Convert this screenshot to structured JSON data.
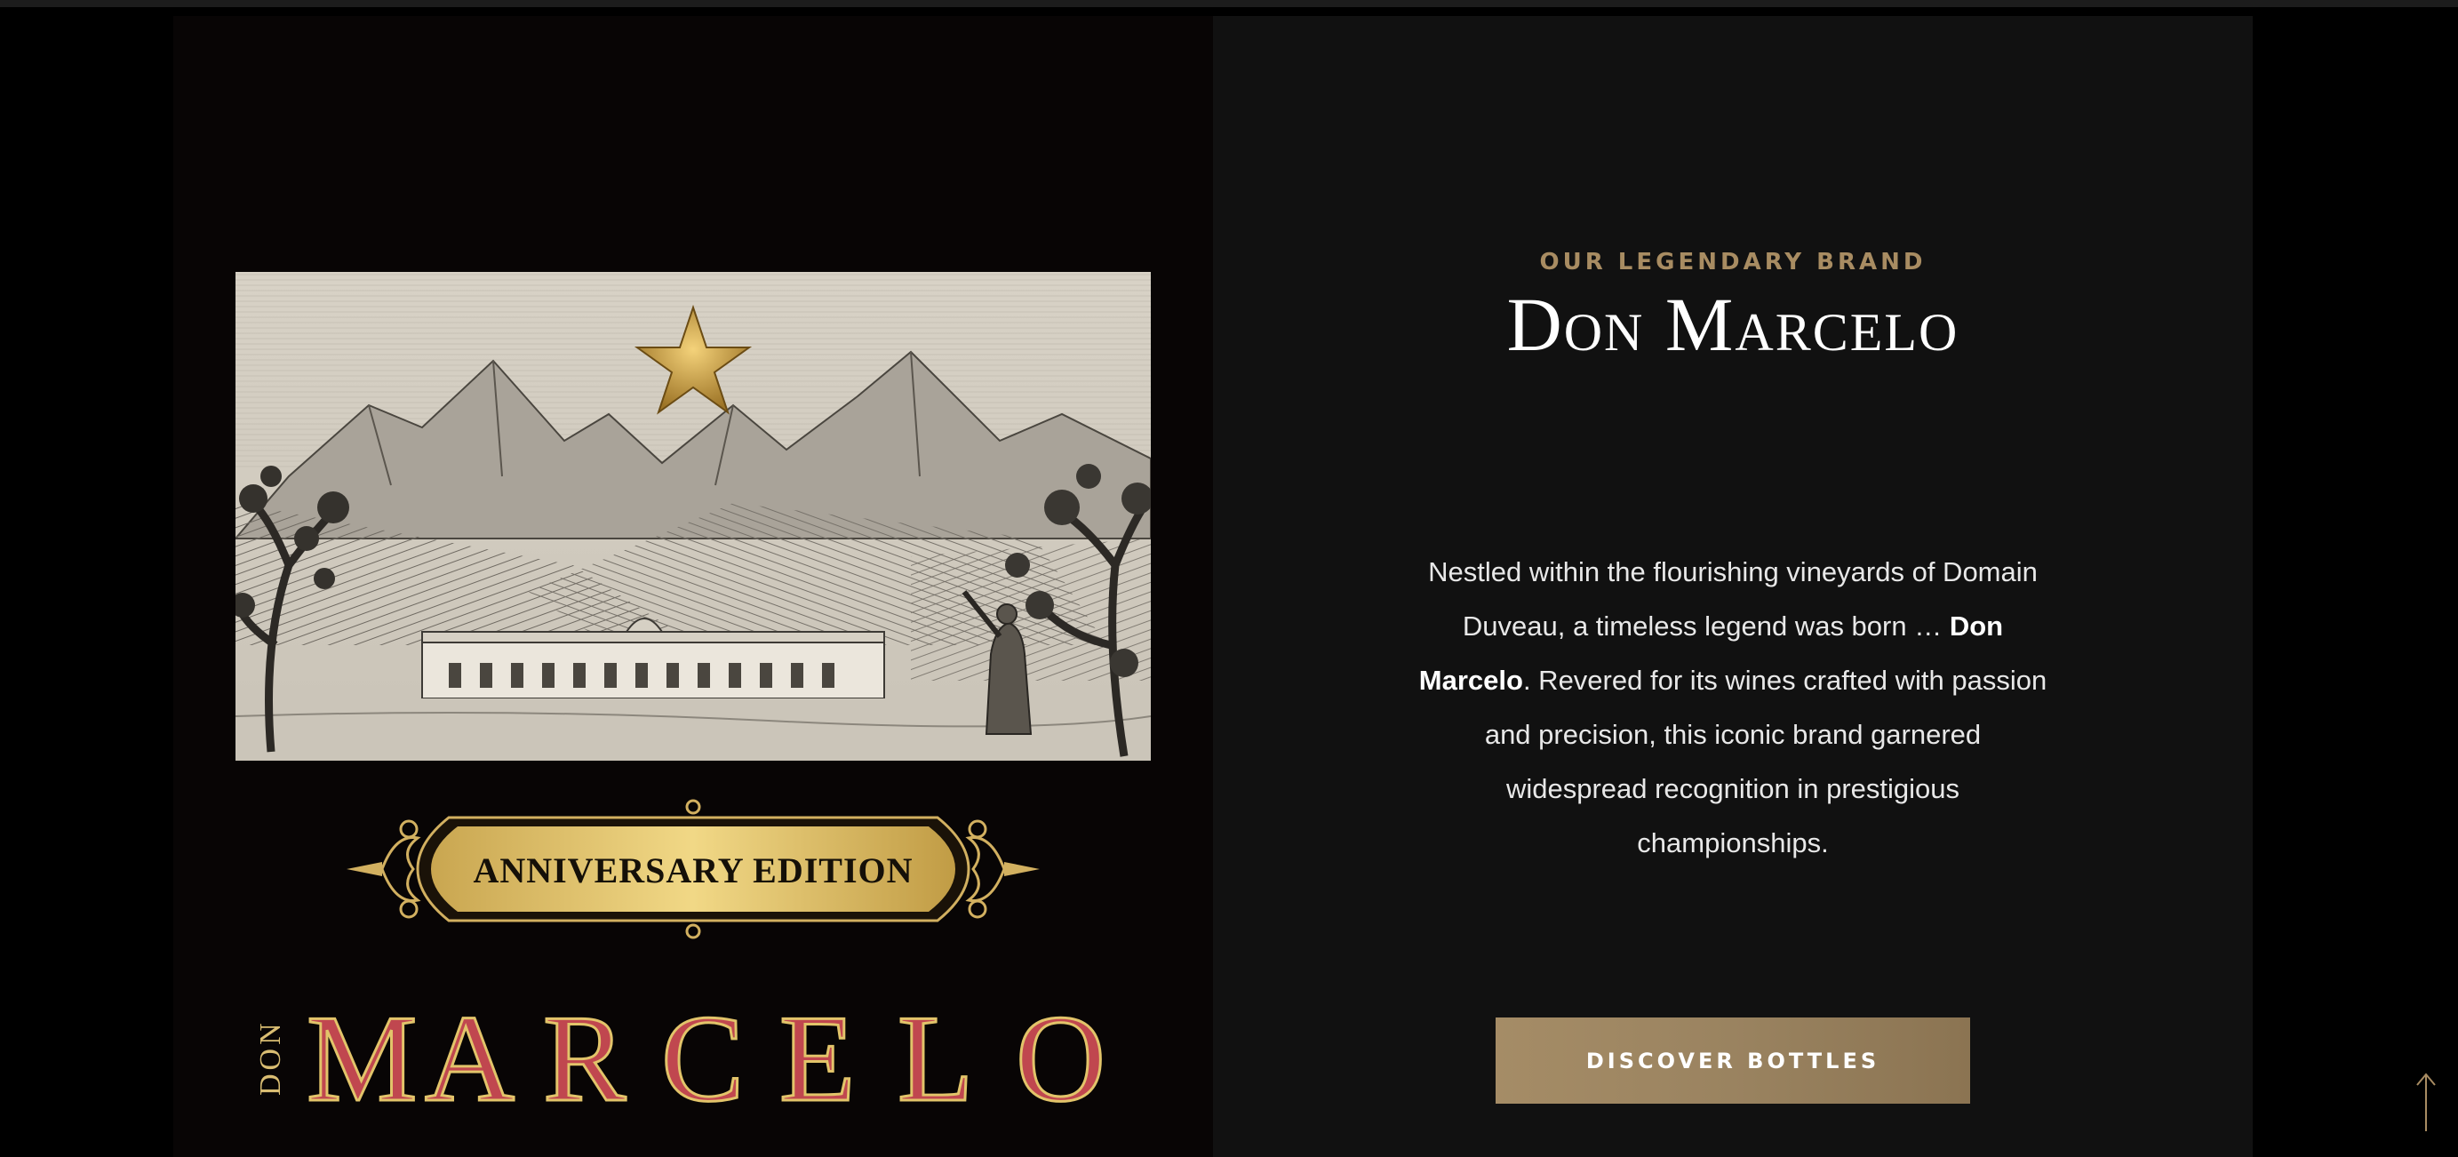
{
  "colors": {
    "page_bg": "#000000",
    "left_panel_bg": "#080505",
    "right_panel_bg": "#111111",
    "accent_gold": "#a88c62",
    "brand_red": "#c0474f",
    "badge_gold": "#e2c46a"
  },
  "label": {
    "badge_text": "ANNIVERSARY EDITION",
    "brand_prefix": "DON",
    "brand_name_letters": [
      "M",
      "A",
      "R",
      "C",
      "E",
      "L",
      "O"
    ]
  },
  "brand_section": {
    "eyebrow": "OUR LEGENDARY BRAND",
    "title": "Don Marcelo",
    "description_before": "Nestled within the flourishing vineyards of Domain Duveau, a timeless legend was born …",
    "description_bold": "Don Marcelo",
    "description_after": ". Revered for its wines crafted with passion and precision, this iconic brand garnered widespread recognition in prestigious championships.",
    "button_label": "DISCOVER BOTTLES"
  },
  "icons": {
    "star": "star-icon",
    "back_to_top": "arrow-up-icon"
  }
}
